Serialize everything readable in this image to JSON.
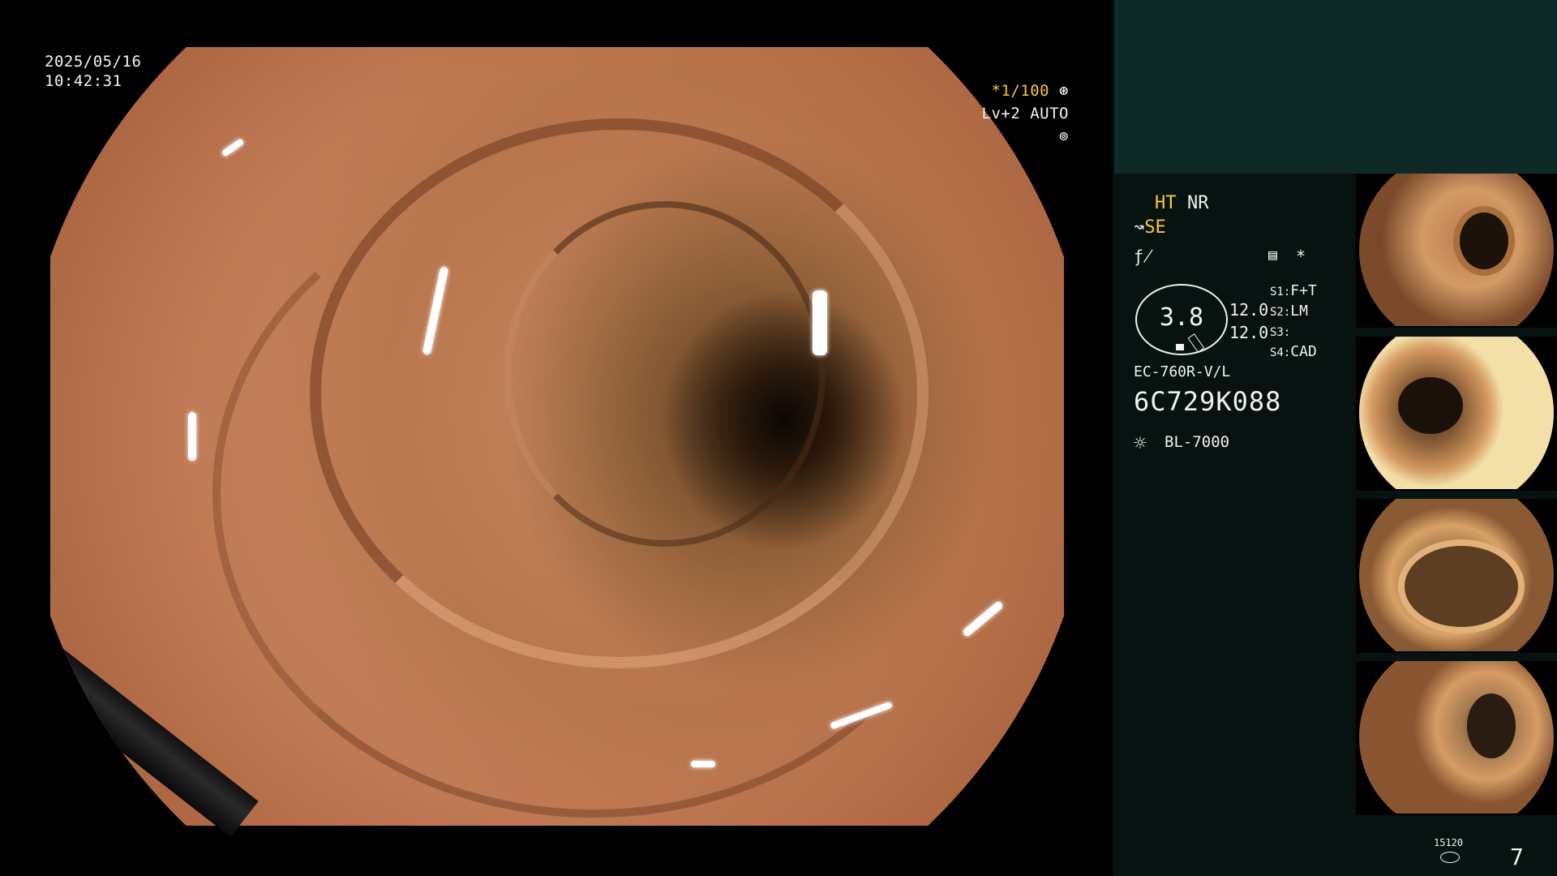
{
  "datetime": {
    "date": "2025/05/16",
    "time": "10:42:31"
  },
  "camera_settings": {
    "shutter": "*1/100",
    "shutter_icon": "aperture-icon",
    "level": "Lv+2 AUTO",
    "level_icon": "auto-iris-icon"
  },
  "modes": {
    "ht": "HT",
    "nr": "NR",
    "se_icon": "scope-tip-icon",
    "se": "SE",
    "freeze_icon": "f-slash-icon",
    "tone_icon": "tone-curve-icon",
    "star": "*"
  },
  "gauge": {
    "value": "3.8",
    "v1": "12.0",
    "v2": "12.0"
  },
  "switches": [
    {
      "key": "S1:",
      "value": "F+T"
    },
    {
      "key": "S2:",
      "value": "LM"
    },
    {
      "key": "S3:",
      "value": ""
    },
    {
      "key": "S4:",
      "value": "CAD"
    }
  ],
  "scope": {
    "model": "EC-760R-V/L",
    "serial": "6C729K088"
  },
  "light_source": {
    "icon": "sun-icon",
    "model": "BL-7000"
  },
  "capture": {
    "label": "15120",
    "count": "7"
  },
  "colors": {
    "accent_yellow": "#ffc62e",
    "panel_bg": "#061311",
    "panel_top": "#0f2a26"
  }
}
